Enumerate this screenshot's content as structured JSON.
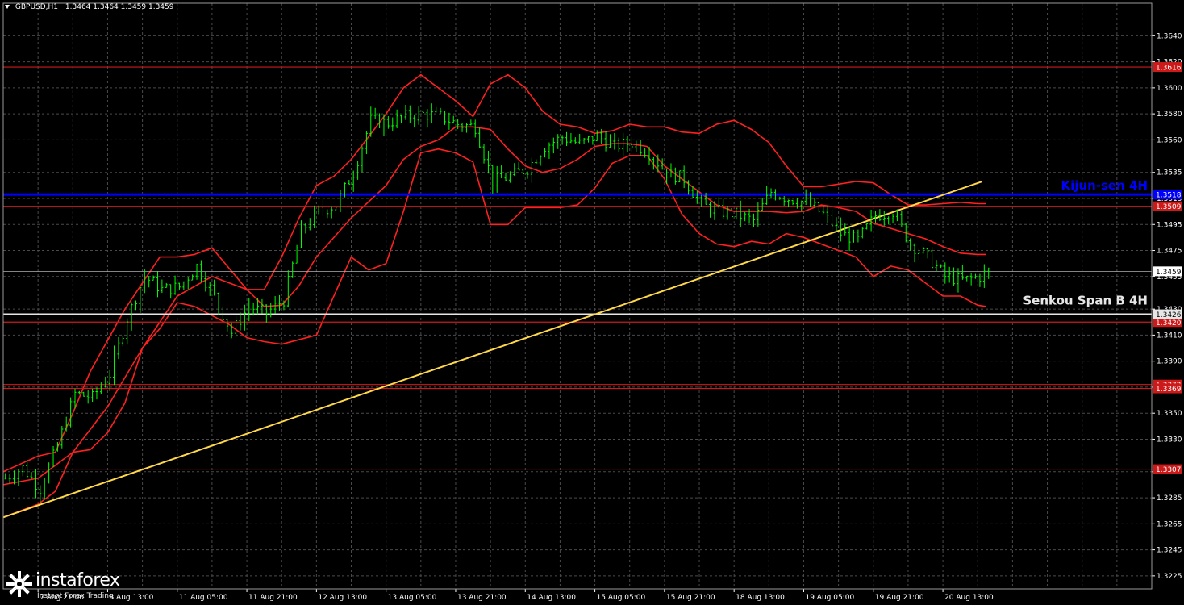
{
  "header": {
    "symbol": "GBPUSD,H1",
    "ohlc": "1.3464 1.3464 1.3459 1.3459"
  },
  "brand": {
    "name": "instaforex",
    "tagline": "Instant Forex Trading",
    "logo": "gear-star-icon"
  },
  "chart_data": {
    "type": "line",
    "instrument": "GBPUSD",
    "timeframe": "H1",
    "colors": {
      "background": "#000000",
      "grid": "#4a4a4a",
      "price": "#00ff00",
      "bollinger": "#ff2020",
      "level": "#cc1a1a",
      "kijun": "#0000ff",
      "senkou": "#e6e6e6",
      "trendline": "#ffd84a",
      "axis_text": "#ffffff"
    },
    "ylim": [
      1.3215,
      1.3665
    ],
    "y_ticks": [
      "1.3640",
      "1.3620",
      "1.3600",
      "1.3580",
      "1.3560",
      "1.3535",
      "1.3515",
      "1.3495",
      "1.3475",
      "1.3455",
      "1.3430",
      "1.3410",
      "1.3390",
      "1.3370",
      "1.3350",
      "1.3330",
      "1.3305",
      "1.3285",
      "1.3265",
      "1.3245",
      "1.3225"
    ],
    "x_ticks": [
      "7 Aug 21:00",
      "8 Aug 13:00",
      "11 Aug 05:00",
      "11 Aug 21:00",
      "12 Aug 13:00",
      "13 Aug 05:00",
      "13 Aug 21:00",
      "14 Aug 13:00",
      "15 Aug 05:00",
      "15 Aug 21:00",
      "18 Aug 13:00",
      "19 Aug 05:00",
      "19 Aug 21:00",
      "20 Aug 13:00"
    ],
    "x_tick_index": [
      8,
      24,
      40,
      56,
      72,
      88,
      104,
      120,
      136,
      152,
      168,
      184,
      200,
      216
    ],
    "x_count": 264,
    "levels": [
      {
        "value": 1.3616,
        "label": "1.3616",
        "kind": "support-resistance"
      },
      {
        "value": 1.3509,
        "label": "1.3509",
        "kind": "support-resistance"
      },
      {
        "value": 1.342,
        "label": "1.3420",
        "kind": "support-resistance"
      },
      {
        "value": 1.3372,
        "label": "1.3372",
        "kind": "support-resistance"
      },
      {
        "value": 1.3369,
        "label": "1.3369",
        "kind": "support-resistance"
      },
      {
        "value": 1.3307,
        "label": "1.3307",
        "kind": "support-resistance"
      }
    ],
    "kijun": {
      "value": 1.3518,
      "label": "1.3518",
      "name": "Kijun-sen 4H"
    },
    "senkou": {
      "value": 1.3426,
      "label": "1.3426",
      "name": "Senkou Span B 4H"
    },
    "current": {
      "value": 1.3459,
      "label": "1.3459"
    },
    "trendline": {
      "x": [
        0,
        225
      ],
      "y": [
        1.327,
        1.3528
      ]
    },
    "price": {
      "x": [
        0,
        4,
        8,
        12,
        16,
        20,
        24,
        28,
        32,
        36,
        40,
        44,
        48,
        52,
        56,
        60,
        64,
        68,
        72,
        76,
        80,
        84,
        88,
        92,
        96,
        100,
        104,
        108,
        112,
        116,
        120,
        124,
        128,
        132,
        136,
        140,
        144,
        148,
        152,
        156,
        160,
        164,
        168,
        172,
        176,
        180,
        184,
        188,
        192,
        196,
        200,
        204,
        208,
        212,
        216,
        220,
        224,
        226
      ],
      "y": [
        1.33,
        1.3308,
        1.3292,
        1.3325,
        1.3365,
        1.3362,
        1.338,
        1.3423,
        1.3455,
        1.3445,
        1.3447,
        1.3463,
        1.344,
        1.3412,
        1.3432,
        1.3427,
        1.3437,
        1.349,
        1.3505,
        1.351,
        1.3535,
        1.3575,
        1.3573,
        1.3578,
        1.358,
        1.3578,
        1.3572,
        1.357,
        1.3528,
        1.3532,
        1.3538,
        1.3555,
        1.3562,
        1.3557,
        1.3563,
        1.3555,
        1.3558,
        1.355,
        1.3535,
        1.353,
        1.351,
        1.3505,
        1.3503,
        1.3498,
        1.352,
        1.3515,
        1.3512,
        1.3503,
        1.3488,
        1.3483,
        1.3502,
        1.3505,
        1.348,
        1.347,
        1.3455,
        1.3452,
        1.3455,
        1.3459
      ]
    },
    "bb_upper": {
      "x": [
        0,
        8,
        12,
        16,
        20,
        28,
        36,
        40,
        44,
        48,
        56,
        60,
        64,
        68,
        72,
        76,
        80,
        88,
        92,
        96,
        100,
        104,
        108,
        112,
        116,
        120,
        124,
        128,
        132,
        136,
        140,
        144,
        148,
        152,
        156,
        160,
        164,
        168,
        172,
        176,
        180,
        184,
        188,
        192,
        196,
        200,
        204,
        208,
        212,
        216,
        220,
        224,
        226
      ],
      "y": [
        1.3305,
        1.3317,
        1.332,
        1.335,
        1.3382,
        1.343,
        1.347,
        1.347,
        1.3472,
        1.3477,
        1.3445,
        1.3445,
        1.347,
        1.35,
        1.3525,
        1.3532,
        1.3545,
        1.358,
        1.36,
        1.361,
        1.36,
        1.359,
        1.3578,
        1.3603,
        1.361,
        1.36,
        1.3582,
        1.3572,
        1.357,
        1.3565,
        1.3567,
        1.3572,
        1.357,
        1.357,
        1.3566,
        1.3565,
        1.3572,
        1.3575,
        1.3568,
        1.3558,
        1.354,
        1.3524,
        1.3524,
        1.3526,
        1.3528,
        1.3527,
        1.3518,
        1.351,
        1.351,
        1.3511,
        1.3512,
        1.3511,
        1.3511
      ]
    },
    "bb_middle": {
      "x": [
        0,
        8,
        16,
        24,
        32,
        40,
        48,
        52,
        56,
        60,
        64,
        68,
        72,
        76,
        80,
        88,
        92,
        96,
        100,
        104,
        108,
        112,
        116,
        120,
        124,
        128,
        132,
        136,
        140,
        144,
        148,
        152,
        156,
        160,
        164,
        168,
        172,
        176,
        180,
        184,
        188,
        192,
        196,
        200,
        204,
        208,
        212,
        216,
        220,
        224,
        226
      ],
      "y": [
        1.3295,
        1.33,
        1.332,
        1.3355,
        1.34,
        1.344,
        1.3455,
        1.345,
        1.3445,
        1.3432,
        1.3433,
        1.3448,
        1.347,
        1.3485,
        1.35,
        1.3525,
        1.3545,
        1.3555,
        1.356,
        1.357,
        1.357,
        1.3568,
        1.3553,
        1.354,
        1.3535,
        1.3538,
        1.3545,
        1.3555,
        1.3557,
        1.3557,
        1.3555,
        1.354,
        1.353,
        1.352,
        1.351,
        1.3505,
        1.3505,
        1.3505,
        1.3504,
        1.3505,
        1.351,
        1.3508,
        1.3505,
        1.3496,
        1.3492,
        1.3488,
        1.3484,
        1.3478,
        1.3473,
        1.3472,
        1.3472
      ]
    },
    "bb_lower": {
      "x": [
        0,
        8,
        12,
        16,
        20,
        24,
        28,
        32,
        36,
        40,
        44,
        48,
        52,
        56,
        60,
        64,
        72,
        80,
        84,
        88,
        92,
        96,
        100,
        104,
        108,
        112,
        116,
        120,
        124,
        128,
        132,
        136,
        140,
        144,
        148,
        152,
        156,
        160,
        164,
        168,
        172,
        176,
        180,
        184,
        188,
        192,
        196,
        200,
        204,
        208,
        212,
        216,
        220,
        224,
        226
      ],
      "y": [
        1.327,
        1.328,
        1.329,
        1.332,
        1.3322,
        1.3335,
        1.3358,
        1.34,
        1.3415,
        1.3435,
        1.3432,
        1.3425,
        1.3418,
        1.3408,
        1.3405,
        1.3403,
        1.341,
        1.347,
        1.346,
        1.3465,
        1.3505,
        1.355,
        1.3553,
        1.355,
        1.3543,
        1.3495,
        1.3495,
        1.3508,
        1.3508,
        1.3508,
        1.351,
        1.3523,
        1.3542,
        1.3548,
        1.3548,
        1.353,
        1.3503,
        1.3488,
        1.348,
        1.3478,
        1.3482,
        1.348,
        1.3488,
        1.3485,
        1.348,
        1.3475,
        1.347,
        1.3455,
        1.3463,
        1.346,
        1.345,
        1.344,
        1.344,
        1.3433,
        1.3432
      ]
    }
  }
}
